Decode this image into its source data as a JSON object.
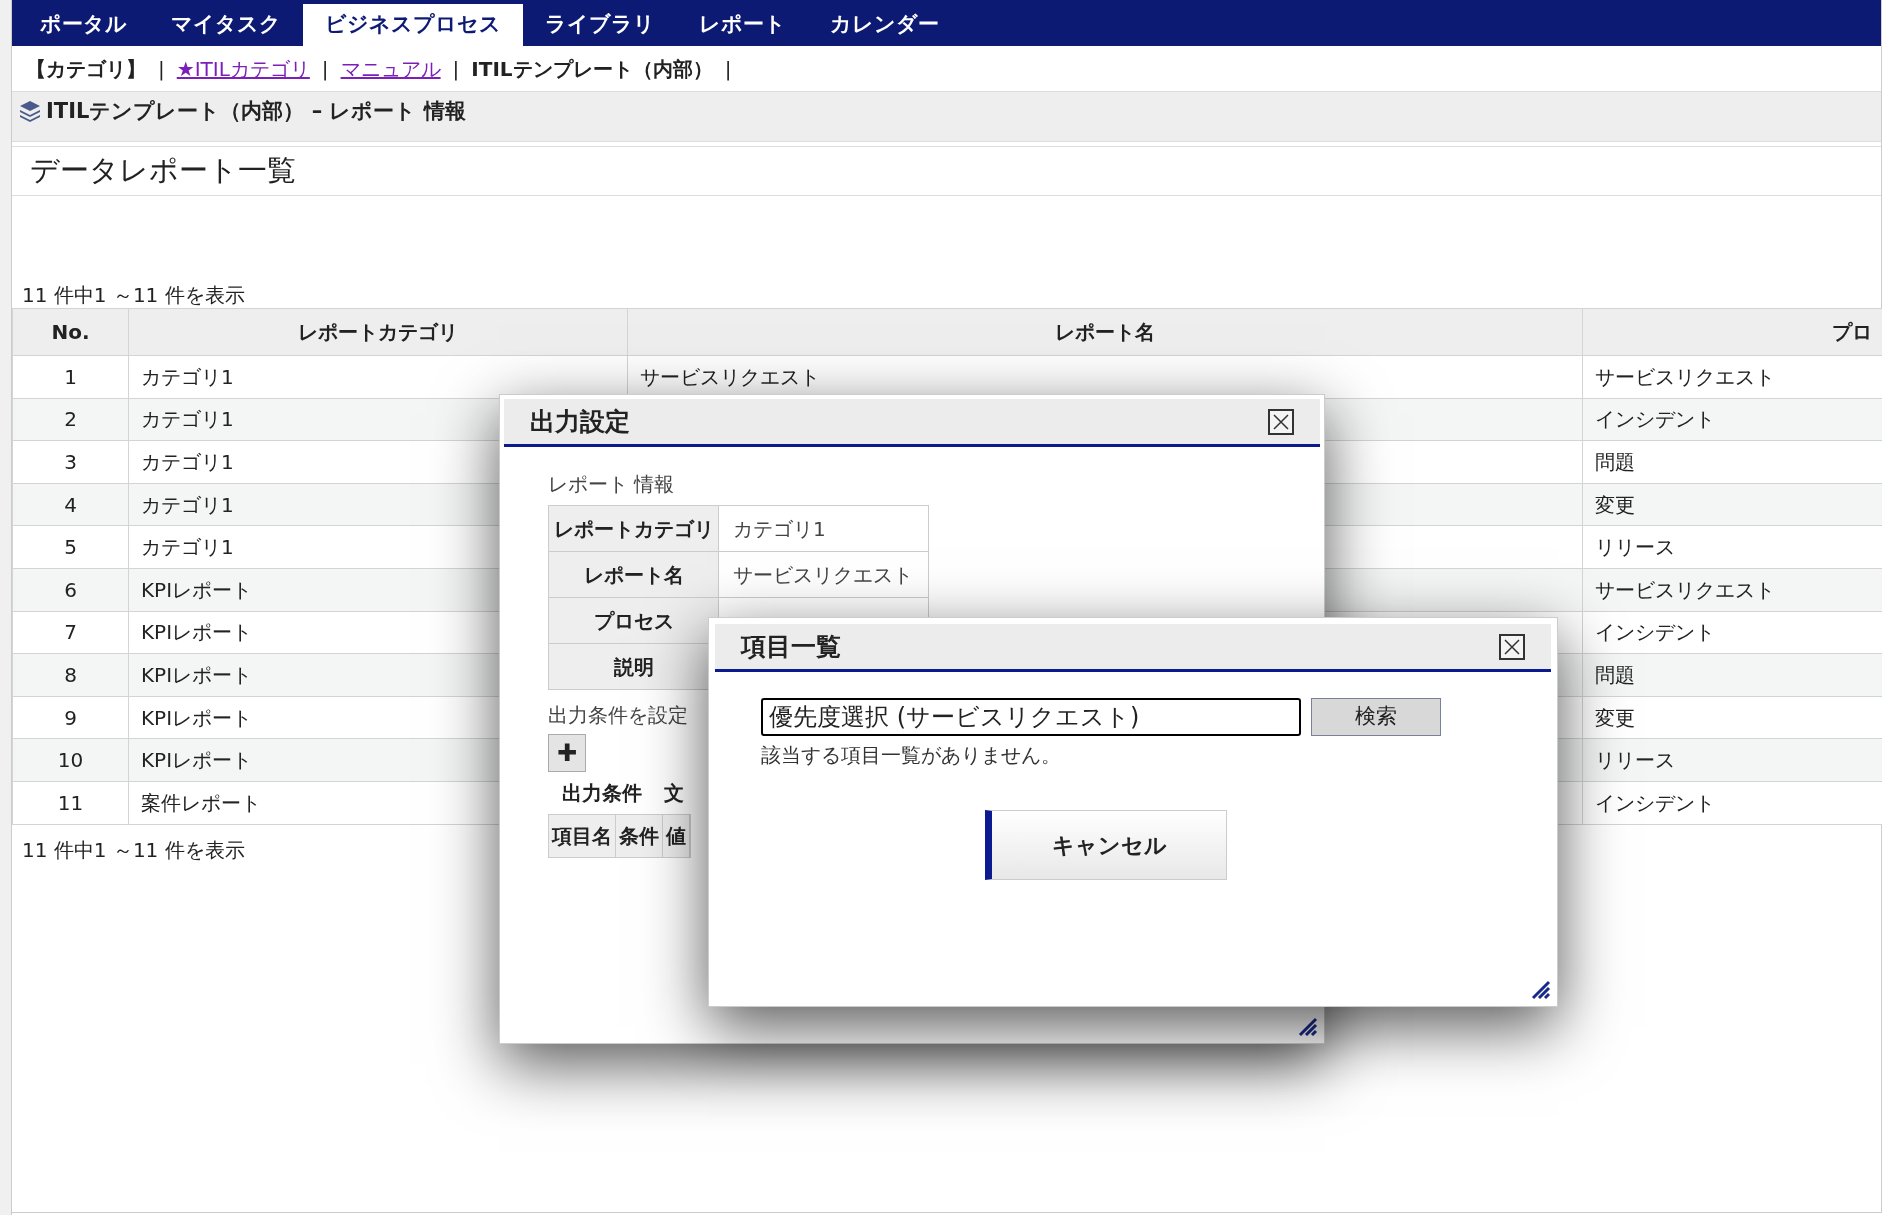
{
  "nav": {
    "tabs": [
      {
        "label": "ポータル",
        "selected": false
      },
      {
        "label": "マイタスク",
        "selected": false
      },
      {
        "label": "ビジネスプロセス",
        "selected": true
      },
      {
        "label": "ライブラリ",
        "selected": false
      },
      {
        "label": "レポート",
        "selected": false
      },
      {
        "label": "カレンダー",
        "selected": false
      }
    ]
  },
  "subnav": [
    {
      "kind": "text",
      "label": "【カテゴリ】"
    },
    {
      "kind": "separator",
      "label": "|"
    },
    {
      "kind": "link",
      "label": "★ITILカテゴリ"
    },
    {
      "kind": "separator",
      "label": "|"
    },
    {
      "kind": "link",
      "label": "マニュアル"
    },
    {
      "kind": "separator",
      "label": "|"
    },
    {
      "kind": "text",
      "label": "ITILテンプレート（内部）"
    },
    {
      "kind": "separator",
      "label": "|"
    }
  ],
  "breadcrumb": "ITILテンプレート（内部） – レポート 情報",
  "page_title": "データレポート一覧",
  "count_top": "11 件中1 ～11 件を表示",
  "table": {
    "columns": [
      "No.",
      "レポートカテゴリ",
      "レポート名",
      "プロ"
    ],
    "rows": [
      {
        "no": "1",
        "category": "カテゴリ1",
        "report_name": "サービスリクエスト",
        "process": "サービスリクエスト"
      },
      {
        "no": "2",
        "category": "カテゴリ1",
        "process": "インシデント"
      },
      {
        "no": "3",
        "category": "カテゴリ1",
        "process": "問題"
      },
      {
        "no": "4",
        "category": "カテゴリ1",
        "process": "変更"
      },
      {
        "no": "5",
        "category": "カテゴリ1",
        "process": "リリース"
      },
      {
        "no": "6",
        "category": "KPIレポート",
        "process": "サービスリクエスト"
      },
      {
        "no": "7",
        "category": "KPIレポート",
        "process": "インシデント"
      },
      {
        "no": "8",
        "category": "KPIレポート",
        "process": "問題"
      },
      {
        "no": "9",
        "category": "KPIレポート",
        "process": "変更"
      },
      {
        "no": "10",
        "category": "KPIレポート",
        "process": "リリース"
      },
      {
        "no": "11",
        "category": "案件レポート",
        "process": "インシデント"
      }
    ]
  },
  "count_bottom": "11 件中1 ～11 件を表示",
  "output_dialog": {
    "title": "出力設定",
    "section": "レポート 情報",
    "info": [
      {
        "label": "レポートカテゴリ",
        "value": "カテゴリ1"
      },
      {
        "label": "レポート名",
        "value": "サービスリクエスト"
      },
      {
        "label": "プロセス"
      },
      {
        "label": "説明"
      }
    ],
    "condition_label": "出力条件を設定",
    "add_button": "✚",
    "condition_heading": "出力条件",
    "condition_heading_2": "文",
    "condition_columns": [
      "項目名",
      "条件",
      "値"
    ]
  },
  "items_dialog": {
    "title": "項目一覧",
    "search_value": "優先度選択 (サービスリクエスト)",
    "search_button": "検索",
    "message": "該当する項目一覧がありません。",
    "cancel_button": "キャンセル"
  }
}
